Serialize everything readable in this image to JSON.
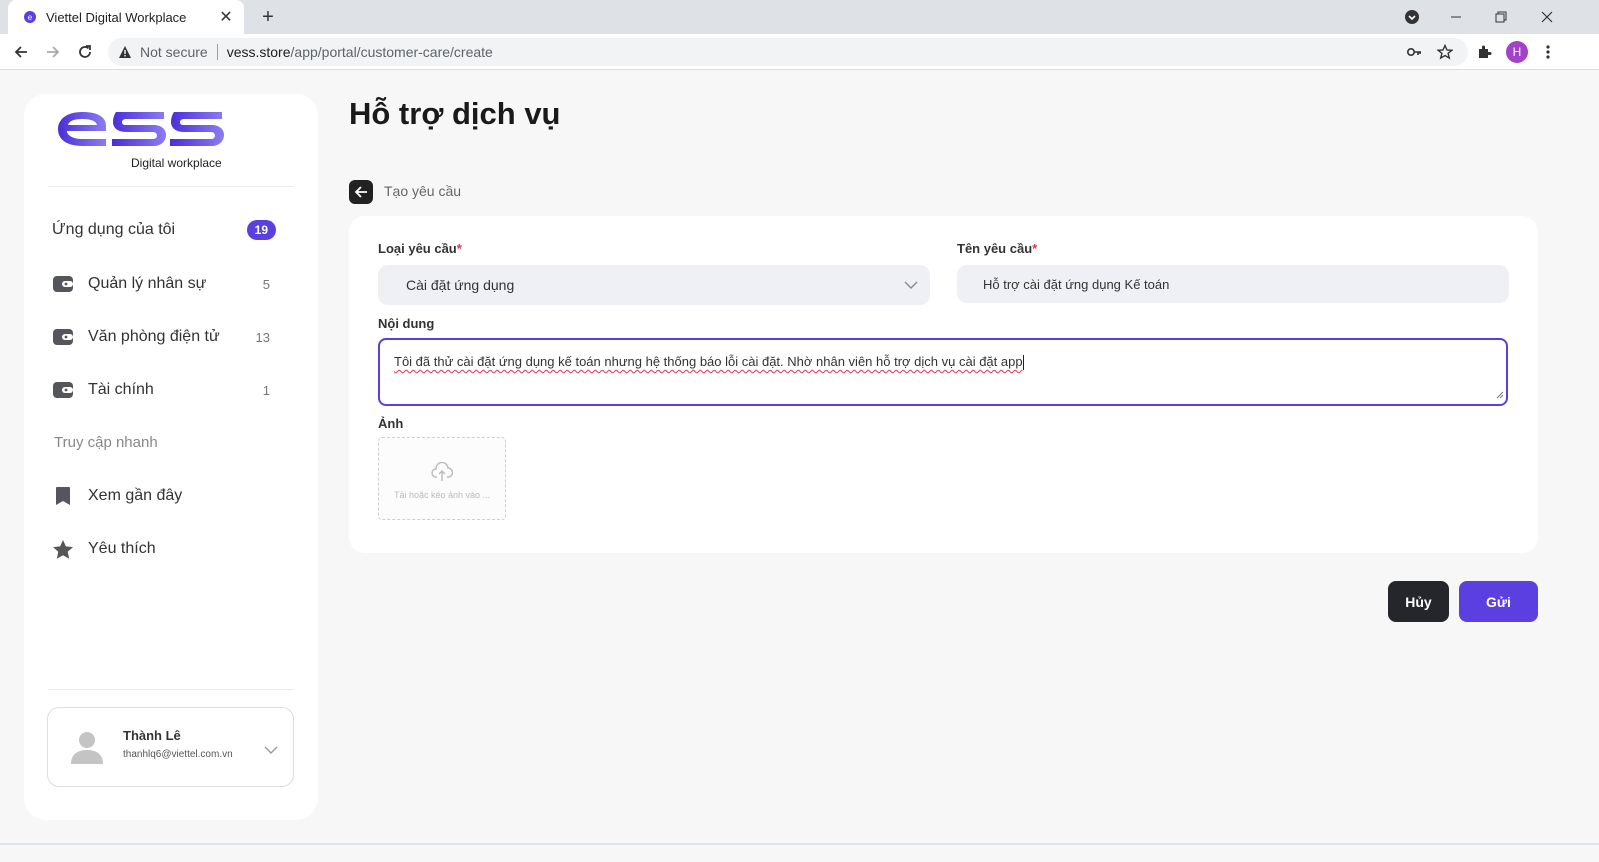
{
  "browser": {
    "tab_title": "Viettel Digital Workplace",
    "new_tab": "+",
    "not_secure": "Not secure",
    "url_host": "vess.store",
    "url_path": "/app/portal/customer-care/create",
    "profile_initial": "H",
    "window_controls": [
      "minimize",
      "restore",
      "close"
    ]
  },
  "sidebar": {
    "logo_sub": "Digital workplace",
    "apps": {
      "label": "Ứng dụng của tôi",
      "count": "19"
    },
    "items": [
      {
        "label": "Quản lý nhân sự",
        "count": "5",
        "icon": "wallet-icon"
      },
      {
        "label": "Văn phòng điện tử",
        "count": "13",
        "icon": "wallet-icon"
      },
      {
        "label": "Tài chính",
        "count": "1",
        "icon": "wallet-icon"
      }
    ],
    "quick_access_label": "Truy cập nhanh",
    "quick": [
      {
        "label": "Xem gần đây",
        "icon": "bookmark-icon"
      },
      {
        "label": "Yêu thích",
        "icon": "star-icon"
      }
    ],
    "user": {
      "name": "Thành Lê",
      "email": "thanhlq6@viettel.com.vn"
    }
  },
  "main": {
    "title": "Hỗ trợ dịch vụ",
    "breadcrumb": "Tạo yêu cầu",
    "form": {
      "type_label": "Loại yêu cầu",
      "type_value": "Cài đặt ứng dụng",
      "name_label": "Tên yêu cầu",
      "name_value": "Hỗ trợ cài đặt ứng dụng Kế toán",
      "content_label": "Nội dung",
      "content_value": "Tôi đã thử cài đặt ứng dụng kế toán nhưng hệ thống báo lỗi cài đặt. Nhờ nhân viên hỗ trợ dịch vụ cài đặt app",
      "image_label": "Ảnh",
      "upload_hint": "Tải hoặc kéo ảnh vào ...",
      "required_mark": "*"
    },
    "buttons": {
      "cancel": "Hủy",
      "send": "Gửi"
    }
  },
  "colors": {
    "accent": "#5b3fe0",
    "dark": "#25262b",
    "required": "#e0344a"
  }
}
